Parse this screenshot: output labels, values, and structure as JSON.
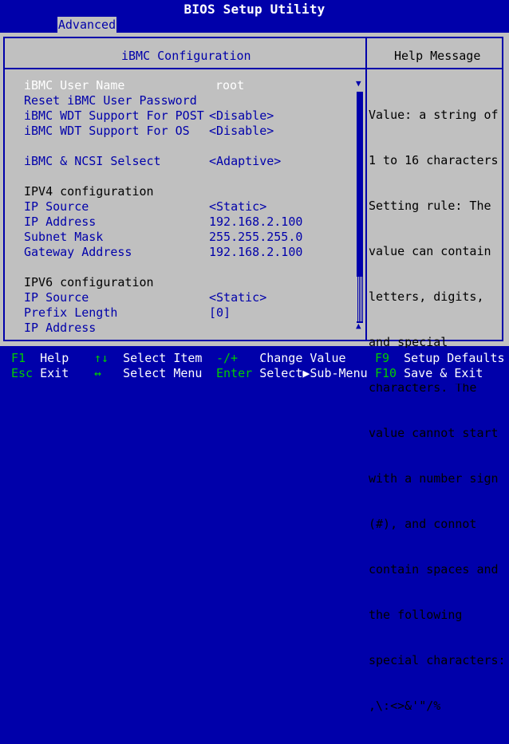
{
  "window": {
    "title": "BIOS Setup Utility"
  },
  "tab": {
    "label": "Advanced"
  },
  "page": {
    "title": "iBMC Configuration",
    "help_title": "Help Message"
  },
  "settings": [
    {
      "label": "iBMC User Name",
      "value": "root"
    },
    {
      "label": "Reset iBMC User Password",
      "value": ""
    },
    {
      "label": "iBMC WDT Support For POST",
      "value": "<Disable>"
    },
    {
      "label": "iBMC WDT Support For OS",
      "value": "<Disable>"
    },
    {
      "label": "iBMC & NCSI Selsect",
      "value": "<Adaptive>"
    },
    {
      "label": "IPV4 configuration",
      "value": ""
    },
    {
      "label": "IP Source",
      "value": "<Static>"
    },
    {
      "label": "IP Address",
      "value": "192.168.2.100"
    },
    {
      "label": "Subnet Mask",
      "value": "255.255.255.0"
    },
    {
      "label": "Gateway Address",
      "value": "192.168.2.100"
    },
    {
      "label": "IPV6 configuration",
      "value": ""
    },
    {
      "label": "IP Source",
      "value": "<Static>"
    },
    {
      "label": "Prefix Length",
      "value": "[0]"
    },
    {
      "label": "IP Address",
      "value": ""
    }
  ],
  "help": {
    "lines": [
      "Value: a string of",
      "1 to 16 characters",
      "Setting rule: The",
      "value can contain",
      "letters, digits,",
      "and special",
      "characters. The",
      "value cannot start",
      "with a number sign",
      "(#), and connot",
      "contain spaces and",
      "the following",
      "special characters:",
      ",\\:<>&'\"/%"
    ]
  },
  "footer": {
    "keys": [
      {
        "key": "F1",
        "desc": "Help"
      },
      {
        "key": "Esc",
        "desc": "Exit"
      },
      {
        "key": "↑↓",
        "desc": "Select Item"
      },
      {
        "key": "↔",
        "desc": "Select Menu"
      },
      {
        "key": "-/+",
        "desc": "Change Value"
      },
      {
        "key": "Enter",
        "desc": "Select▶Sub-Menu"
      },
      {
        "key": "F9",
        "desc": "Setup Defaults"
      },
      {
        "key": "F10",
        "desc": "Save & Exit"
      }
    ]
  },
  "colors": {
    "background": "#0000aa",
    "panel": "#c0c0c0",
    "key": "#00cc00",
    "highlight": "#ffffff"
  },
  "icons": {
    "scroll_up": "triangle-up-icon",
    "scroll_down": "triangle-down-icon"
  }
}
